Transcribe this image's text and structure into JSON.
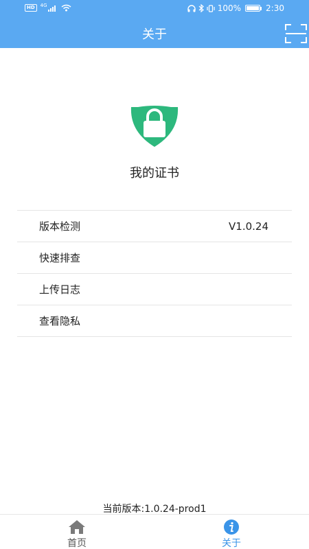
{
  "status_bar": {
    "hd": "HD",
    "network": "4G",
    "battery_percent": "100%",
    "time": "2:30"
  },
  "header": {
    "title": "关于",
    "scan_icon": "scan-icon"
  },
  "cert": {
    "icon": "shield-lock-icon",
    "title": "我的证书"
  },
  "menu": {
    "items": [
      {
        "label": "版本检测",
        "value": "V1.0.24"
      },
      {
        "label": "快速排查",
        "value": ""
      },
      {
        "label": "上传日志",
        "value": ""
      },
      {
        "label": "查看隐私",
        "value": ""
      }
    ]
  },
  "footer": {
    "version_text": "当前版本:1.0.24-prod1"
  },
  "bottom_nav": {
    "items": [
      {
        "label": "首页",
        "icon": "home-icon",
        "active": false
      },
      {
        "label": "关于",
        "icon": "info-icon",
        "active": true
      }
    ]
  },
  "colors": {
    "header": "#5aa9f2",
    "shield": "#2db87d",
    "active_tab": "#3a94e8",
    "inactive_icon": "#7a7a7a"
  }
}
